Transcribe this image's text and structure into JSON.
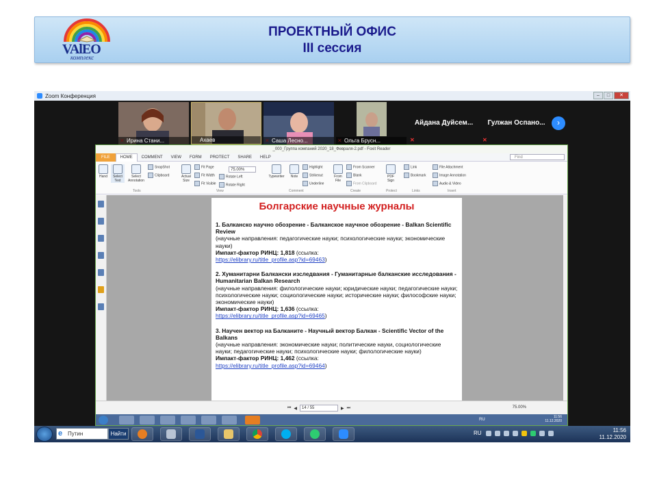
{
  "slide": {
    "title_line1": "ПРОЕКТНЫЙ ОФИС",
    "title_line2": "III сессия",
    "logo_text": "VAlEO",
    "logo_sub": "комплекс"
  },
  "zoom": {
    "window_title": "Zoom Конференция",
    "participants": [
      {
        "name": "Ирина Стани...",
        "muted": true
      },
      {
        "name": "Ахаев",
        "muted": false
      },
      {
        "name": "Саша Лесно...",
        "muted": true
      },
      {
        "name": "Ольга Брусн...",
        "muted": true
      },
      {
        "name": "Айдана Дуйсем...",
        "muted": true
      },
      {
        "name": "Гулжан Оспано...",
        "muted": true
      }
    ]
  },
  "foxit": {
    "title": "_000_Группа компаний 2020_18_Февраля-2.pdf - Foxit Reader",
    "tabs": [
      "FILE",
      "HOME",
      "COMMENT",
      "VIEW",
      "FORM",
      "PROTECT",
      "SHARE",
      "HELP"
    ],
    "find_placeholder": "Find",
    "zoom_value": "75.00%",
    "ribbon": {
      "hand": "Hand",
      "select_text": "Select Text",
      "select_annotation": "Select Annotation",
      "snapshot": "SnapShot",
      "clipboard": "Clipboard",
      "actual_size": "Actual Size",
      "fit_page": "Fit Page",
      "fit_width": "Fit Width",
      "fit_visible": "Fit Visible",
      "rotate_left": "Rotate Left",
      "rotate_right": "Rotate Right",
      "typewriter": "Typewriter",
      "note": "Note",
      "highlight": "Highlight",
      "strikeout": "Strikeout",
      "underline": "Underline",
      "from_file": "From File",
      "from_scanner": "From Scanner",
      "blank": "Blank",
      "from_clipboard": "From Clipboard",
      "pdf_sign": "PDF Sign",
      "link": "Link",
      "bookmark": "Bookmark",
      "file_attachment": "File Attachment",
      "image_annotation": "Image Annotation",
      "audio_video": "Audio & Video",
      "groups": [
        "Tools",
        "View",
        "Comment",
        "Create",
        "Protect",
        "Links",
        "Insert"
      ]
    },
    "page": {
      "heading": "Болгарские научные журналы",
      "entries": [
        {
          "title": "1. Балканско научно обозрение - Балканское научное обозрение - Balkan Scientific Review",
          "areas": "(научные направления: педагогические науки; психологические науки; экономические науки)",
          "impact_label": "Импакт-фактор РИНЦ: 1,818",
          "impact_suffix": " (ссылка:",
          "link": "https://elibrary.ru/title_profile.asp?id=69463",
          "close": ")"
        },
        {
          "title": "2. Хуманитарни Балкански изследвания - Гуманитарные балканские исследования -  Humanitarian Balkan Research",
          "areas": "(научные направления: филологические науки; юридические науки; педагогические науки; психологические науки; социологические науки; исторические науки; философские науки; экономические науки)",
          "impact_label": "Импакт-фактор РИНЦ: 1,636",
          "impact_suffix": " (ссылка:",
          "link": "https://elibrary.ru/title_profile.asp?id=69465",
          "close": ")"
        },
        {
          "title": "3. Научен вектор на Балканите - Научный вектор Балкан - Scientific Vector of the Balkans",
          "areas": "(научные направления: экономические науки; политические науки, социологические науки; педагогические науки; психологические науки; филологические науки)",
          "impact_label": "Импакт-фактор РИНЦ: 1,462",
          "impact_suffix": " (ссылка:",
          "link": "https://elibrary.ru/title_profile.asp?id=69464",
          "close": ")"
        }
      ]
    },
    "status": {
      "page_indicator": "14 / 55",
      "zoom": "75.00%"
    },
    "inner_tray": {
      "lang": "RU",
      "time": "11:56",
      "date": "11.12.2020"
    }
  },
  "taskbar": {
    "search_text": "Путин",
    "find_button": "Найти",
    "lang": "RU",
    "time": "11:56",
    "date": "11.12.2020"
  },
  "colors": {
    "header_bg": "#a9d0f0",
    "title_color": "#1a1a8c",
    "page_heading": "#d21f1f",
    "link": "#1d3fc4",
    "foxit_border": "#6aa84f",
    "zoom_blue": "#2d8cff"
  }
}
